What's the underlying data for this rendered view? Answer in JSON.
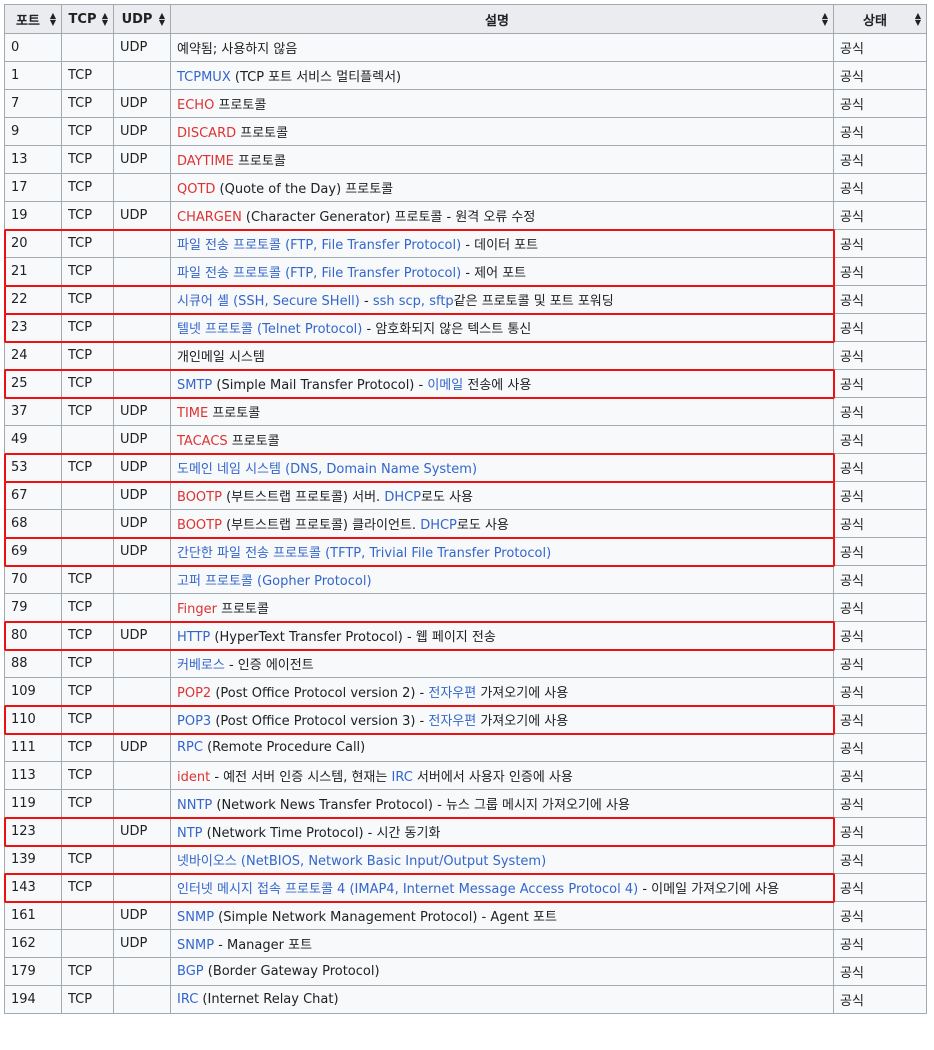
{
  "headers": {
    "port": "포트",
    "tcp": "TCP",
    "udp": "UDP",
    "desc": "설명",
    "status": "상태"
  },
  "rows": [
    {
      "port": "0",
      "tcp": "",
      "udp": "UDP",
      "desc": [
        {
          "t": "예약됨; 사용하지 않음"
        }
      ],
      "status": "공식"
    },
    {
      "port": "1",
      "tcp": "TCP",
      "udp": "",
      "desc": [
        {
          "t": "TCPMUX",
          "c": "blue"
        },
        {
          "t": " (TCP 포트 서비스 멀티플렉서)"
        }
      ],
      "status": "공식"
    },
    {
      "port": "7",
      "tcp": "TCP",
      "udp": "UDP",
      "desc": [
        {
          "t": "ECHO",
          "c": "red"
        },
        {
          "t": " 프로토콜"
        }
      ],
      "status": "공식"
    },
    {
      "port": "9",
      "tcp": "TCP",
      "udp": "UDP",
      "desc": [
        {
          "t": "DISCARD",
          "c": "red"
        },
        {
          "t": " 프로토콜"
        }
      ],
      "status": "공식"
    },
    {
      "port": "13",
      "tcp": "TCP",
      "udp": "UDP",
      "desc": [
        {
          "t": "DAYTIME",
          "c": "red"
        },
        {
          "t": " 프로토콜"
        }
      ],
      "status": "공식"
    },
    {
      "port": "17",
      "tcp": "TCP",
      "udp": "",
      "desc": [
        {
          "t": "QOTD",
          "c": "red"
        },
        {
          "t": " (Quote of the Day) 프로토콜"
        }
      ],
      "status": "공식"
    },
    {
      "port": "19",
      "tcp": "TCP",
      "udp": "UDP",
      "desc": [
        {
          "t": "CHARGEN",
          "c": "red"
        },
        {
          "t": " (Character Generator) 프로토콜 - 원격 오류 수정"
        }
      ],
      "status": "공식"
    },
    {
      "port": "20",
      "tcp": "TCP",
      "udp": "",
      "desc": [
        {
          "t": "파일 전송 프로토콜 (FTP, File Transfer Protocol)",
          "c": "blue"
        },
        {
          "t": " - 데이터 포트"
        }
      ],
      "status": "공식"
    },
    {
      "port": "21",
      "tcp": "TCP",
      "udp": "",
      "desc": [
        {
          "t": "파일 전송 프로토콜 (FTP, File Transfer Protocol)",
          "c": "blue"
        },
        {
          "t": " - 제어 포트"
        }
      ],
      "status": "공식"
    },
    {
      "port": "22",
      "tcp": "TCP",
      "udp": "",
      "desc": [
        {
          "t": "시큐어 셸 (SSH, Secure SHell)",
          "c": "blue"
        },
        {
          "t": " - "
        },
        {
          "t": "ssh scp, sftp",
          "c": "blue"
        },
        {
          "t": "같은 프로토콜 및 포트 포워딩"
        }
      ],
      "status": "공식"
    },
    {
      "port": "23",
      "tcp": "TCP",
      "udp": "",
      "desc": [
        {
          "t": "텔넷 프로토콜 (Telnet Protocol)",
          "c": "blue"
        },
        {
          "t": " - 암호화되지 않은 텍스트 통신"
        }
      ],
      "status": "공식"
    },
    {
      "port": "24",
      "tcp": "TCP",
      "udp": "",
      "desc": [
        {
          "t": "개인메일 시스템"
        }
      ],
      "status": "공식"
    },
    {
      "port": "25",
      "tcp": "TCP",
      "udp": "",
      "desc": [
        {
          "t": "SMTP",
          "c": "blue"
        },
        {
          "t": " (Simple Mail Transfer Protocol) - "
        },
        {
          "t": "이메일",
          "c": "blue"
        },
        {
          "t": " 전송에 사용"
        }
      ],
      "status": "공식"
    },
    {
      "port": "37",
      "tcp": "TCP",
      "udp": "UDP",
      "desc": [
        {
          "t": "TIME",
          "c": "red"
        },
        {
          "t": " 프로토콜"
        }
      ],
      "status": "공식"
    },
    {
      "port": "49",
      "tcp": "",
      "udp": "UDP",
      "desc": [
        {
          "t": "TACACS",
          "c": "red"
        },
        {
          "t": " 프로토콜"
        }
      ],
      "status": "공식"
    },
    {
      "port": "53",
      "tcp": "TCP",
      "udp": "UDP",
      "desc": [
        {
          "t": "도메인 네임 시스템 (DNS, Domain Name System)",
          "c": "blue"
        }
      ],
      "status": "공식"
    },
    {
      "port": "67",
      "tcp": "",
      "udp": "UDP",
      "desc": [
        {
          "t": "BOOTP",
          "c": "red"
        },
        {
          "t": " (부트스트랩 프로토콜) 서버. "
        },
        {
          "t": "DHCP",
          "c": "blue"
        },
        {
          "t": "로도 사용"
        }
      ],
      "status": "공식"
    },
    {
      "port": "68",
      "tcp": "",
      "udp": "UDP",
      "desc": [
        {
          "t": "BOOTP",
          "c": "red"
        },
        {
          "t": " (부트스트랩 프로토콜) 클라이언트. "
        },
        {
          "t": "DHCP",
          "c": "blue"
        },
        {
          "t": "로도 사용"
        }
      ],
      "status": "공식"
    },
    {
      "port": "69",
      "tcp": "",
      "udp": "UDP",
      "desc": [
        {
          "t": "간단한 파일 전송 프로토콜 (TFTP, Trivial File Transfer Protocol)",
          "c": "blue"
        }
      ],
      "status": "공식"
    },
    {
      "port": "70",
      "tcp": "TCP",
      "udp": "",
      "desc": [
        {
          "t": "고퍼 프로토콜 (Gopher Protocol)",
          "c": "blue"
        }
      ],
      "status": "공식"
    },
    {
      "port": "79",
      "tcp": "TCP",
      "udp": "",
      "desc": [
        {
          "t": "Finger",
          "c": "red"
        },
        {
          "t": " 프로토콜"
        }
      ],
      "status": "공식"
    },
    {
      "port": "80",
      "tcp": "TCP",
      "udp": "UDP",
      "desc": [
        {
          "t": "HTTP",
          "c": "blue"
        },
        {
          "t": " (HyperText Transfer Protocol) - 웹 페이지 전송"
        }
      ],
      "status": "공식"
    },
    {
      "port": "88",
      "tcp": "TCP",
      "udp": "",
      "desc": [
        {
          "t": "커베로스",
          "c": "blue"
        },
        {
          "t": " - 인증 에이전트"
        }
      ],
      "status": "공식"
    },
    {
      "port": "109",
      "tcp": "TCP",
      "udp": "",
      "desc": [
        {
          "t": "POP2",
          "c": "red"
        },
        {
          "t": " (Post Office Protocol version 2) - "
        },
        {
          "t": "전자우편",
          "c": "blue"
        },
        {
          "t": " 가져오기에 사용"
        }
      ],
      "status": "공식"
    },
    {
      "port": "110",
      "tcp": "TCP",
      "udp": "",
      "desc": [
        {
          "t": "POP3",
          "c": "blue"
        },
        {
          "t": " (Post Office Protocol version 3) - "
        },
        {
          "t": "전자우편",
          "c": "blue"
        },
        {
          "t": " 가져오기에 사용"
        }
      ],
      "status": "공식"
    },
    {
      "port": "111",
      "tcp": "TCP",
      "udp": "UDP",
      "desc": [
        {
          "t": "RPC",
          "c": "blue"
        },
        {
          "t": " (Remote Procedure Call)"
        }
      ],
      "status": "공식"
    },
    {
      "port": "113",
      "tcp": "TCP",
      "udp": "",
      "desc": [
        {
          "t": "ident",
          "c": "red"
        },
        {
          "t": " - 예전 서버 인증 시스템, 현재는 "
        },
        {
          "t": "IRC",
          "c": "blue"
        },
        {
          "t": " 서버에서 사용자 인증에 사용"
        }
      ],
      "status": "공식"
    },
    {
      "port": "119",
      "tcp": "TCP",
      "udp": "",
      "desc": [
        {
          "t": "NNTP",
          "c": "blue"
        },
        {
          "t": " (Network News Transfer Protocol) - 뉴스 그룹 메시지 가져오기에 사용"
        }
      ],
      "status": "공식"
    },
    {
      "port": "123",
      "tcp": "",
      "udp": "UDP",
      "desc": [
        {
          "t": "NTP",
          "c": "blue"
        },
        {
          "t": " (Network Time Protocol) - 시간 동기화"
        }
      ],
      "status": "공식"
    },
    {
      "port": "139",
      "tcp": "TCP",
      "udp": "",
      "desc": [
        {
          "t": "넷바이오스 (NetBIOS, Network Basic Input/Output System)",
          "c": "blue"
        }
      ],
      "status": "공식"
    },
    {
      "port": "143",
      "tcp": "TCP",
      "udp": "",
      "desc": [
        {
          "t": "인터넷 메시지 접속 프로토콜 4 (IMAP4, Internet Message Access Protocol 4)",
          "c": "blue"
        },
        {
          "t": " - 이메일 가져오기에 사용"
        }
      ],
      "status": "공식"
    },
    {
      "port": "161",
      "tcp": "",
      "udp": "UDP",
      "desc": [
        {
          "t": "SNMP",
          "c": "blue"
        },
        {
          "t": " (Simple Network Management Protocol) - Agent 포트"
        }
      ],
      "status": "공식"
    },
    {
      "port": "162",
      "tcp": "",
      "udp": "UDP",
      "desc": [
        {
          "t": "SNMP",
          "c": "blue"
        },
        {
          "t": " - Manager 포트"
        }
      ],
      "status": "공식"
    },
    {
      "port": "179",
      "tcp": "TCP",
      "udp": "",
      "desc": [
        {
          "t": "BGP",
          "c": "blue"
        },
        {
          "t": " (Border Gateway Protocol)"
        }
      ],
      "status": "공식"
    },
    {
      "port": "194",
      "tcp": "TCP",
      "udp": "",
      "desc": [
        {
          "t": "IRC",
          "c": "blue"
        },
        {
          "t": " (Internet Relay Chat)"
        }
      ],
      "status": "공식"
    }
  ],
  "highlight_groups": [
    [
      7,
      8
    ],
    [
      9
    ],
    [
      10
    ],
    [
      12
    ],
    [
      15
    ],
    [
      16,
      17
    ],
    [
      18
    ],
    [
      21
    ],
    [
      24
    ],
    [
      28
    ],
    [
      30
    ]
  ],
  "colors": {
    "link": "#3366cc",
    "redlink": "#dd3333",
    "highlight": "#ee1111",
    "header_bg": "#eaecf0",
    "cell_bg": "#f8f9fa",
    "border": "#a2a9b1"
  }
}
